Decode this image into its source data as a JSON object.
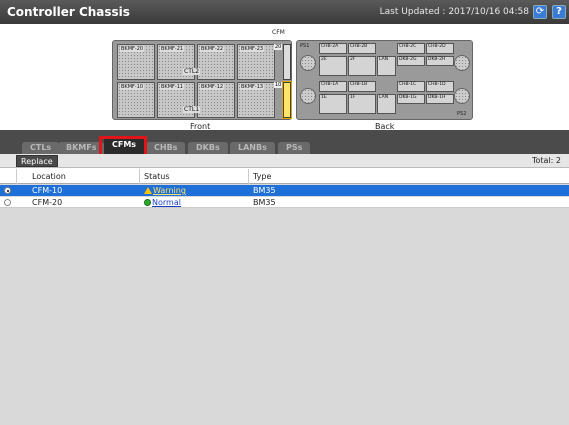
{
  "header": {
    "title": "Controller Chassis",
    "last_updated": "Last Updated : 2017/10/16 04:58",
    "refresh_icon": "refresh-icon",
    "help_label": "?"
  },
  "diagram": {
    "front_caption": "Front",
    "back_caption": "Back",
    "cfm_caption": "CFM",
    "front": {
      "top_bays": [
        "BKMF-20",
        "BKMF-21",
        "BKMF-22",
        "BKMF-23"
      ],
      "bottom_bays": [
        "BKMF-10",
        "BKMF-11",
        "BKMF-12",
        "BKMF-13"
      ],
      "ctl_top": "CTL2",
      "ctl_bottom": "CTL1",
      "cfm_top": "20",
      "cfm_bottom": "10"
    },
    "back": {
      "ps_top": "PS1",
      "ps_bottom": "PS2",
      "top_cells": [
        "CHB-2A",
        "CHB-2B",
        "CHB-2C",
        "CHB-2D"
      ],
      "top_mid": [
        "2E",
        "2F",
        "LAN"
      ],
      "top_lower": [
        "DKB-2G",
        "DKB-2H"
      ],
      "bottom_cells": [
        "CHB-1A",
        "CHB-1B",
        "CHB-1C",
        "CHB-1D"
      ],
      "bottom_mid": [
        "1E",
        "1F",
        "LAN"
      ],
      "bottom_lower": [
        "DKB-1G",
        "DKB-1H"
      ]
    }
  },
  "tabs": [
    {
      "label": "CTLs",
      "active": false
    },
    {
      "label": "BKMFs",
      "active": false
    },
    {
      "label": "CFMs",
      "active": true
    },
    {
      "label": "CHBs",
      "active": false
    },
    {
      "label": "DKBs",
      "active": false
    },
    {
      "label": "LANBs",
      "active": false
    },
    {
      "label": "PSs",
      "active": false
    }
  ],
  "toolbar": {
    "replace_label": "Replace",
    "total": "Total: 2"
  },
  "table": {
    "columns": [
      "Location",
      "Status",
      "Type"
    ],
    "rows": [
      {
        "location": "CFM-10",
        "status": "Warning",
        "status_icon": "warning-icon",
        "type": "BM35",
        "selected": true
      },
      {
        "location": "CFM-20",
        "status": "Normal",
        "status_icon": "normal-icon",
        "type": "BM35",
        "selected": false
      }
    ]
  },
  "colors": {
    "accent_selected_row": "#1f6fd8",
    "highlight_box": "#e0151a",
    "warning": "#f5c400",
    "normal": "#2eaa2e"
  }
}
